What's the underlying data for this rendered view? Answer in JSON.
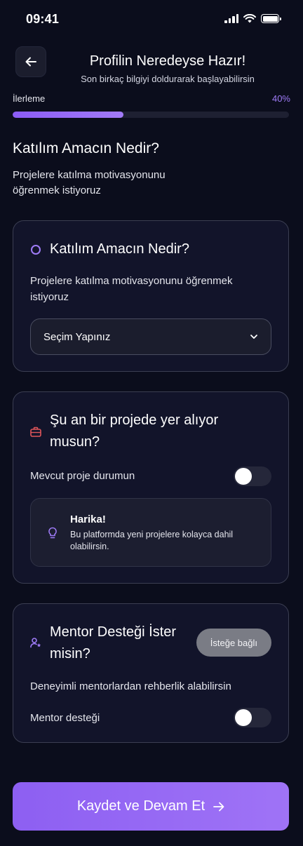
{
  "status": {
    "time": "09:41"
  },
  "header": {
    "title": "Profilin Neredeyse Hazır!",
    "subtitle": "Son birkaç bilgiyi doldurarak başlayabilirsin"
  },
  "progress": {
    "label": "İlerleme",
    "value_text": "40%",
    "value": 0.4
  },
  "section": {
    "title": "Katılım Amacın Nedir?",
    "description": "Projelere katılma motivasyonunu öğrenmek istiyoruz"
  },
  "purpose_card": {
    "title": "Katılım Amacın Nedir?",
    "description": "Projelere katılma motivasyonunu öğrenmek istiyoruz",
    "select_value": "Seçim Yapınız"
  },
  "project_card": {
    "title": "Şu an bir projede yer alıyor musun?",
    "toggle_label": "Mevcut proje durumun",
    "toggle_on": false,
    "info_title": "Harika!",
    "info_text": "Bu platformda yeni projelere kolayca dahil olabilirsin."
  },
  "mentor_card": {
    "title": "Mentor Desteği İster misin?",
    "badge": "İsteğe bağlı",
    "description": "Deneyimli mentorlardan rehberlik alabilirsin",
    "toggle_label": "Mentor desteği",
    "toggle_on": false
  },
  "cta": {
    "label": "Kaydet ve Devam Et"
  },
  "colors": {
    "accent": "#8b5cf6",
    "background": "#0b0d1c",
    "card": "#12142a",
    "briefcase": "#e0565b"
  }
}
